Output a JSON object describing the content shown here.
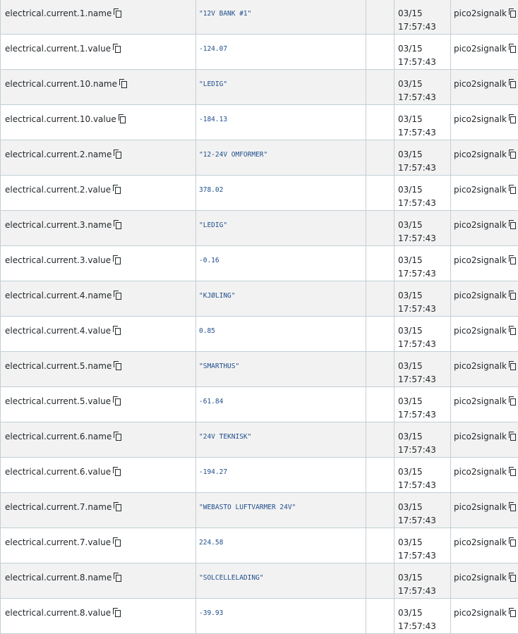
{
  "rows": [
    {
      "path": "electrical.current.1.name",
      "value": "\"12V BANK #1\"",
      "date": "03/15",
      "time": "17:57:43",
      "source": "pico2signalk"
    },
    {
      "path": "electrical.current.1.value",
      "value": "-124.07",
      "date": "03/15",
      "time": "17:57:43",
      "source": "pico2signalk"
    },
    {
      "path": "electrical.current.10.name",
      "value": "\"LEDIG\"",
      "date": "03/15",
      "time": "17:57:43",
      "source": "pico2signalk"
    },
    {
      "path": "electrical.current.10.value",
      "value": "-184.13",
      "date": "03/15",
      "time": "17:57:43",
      "source": "pico2signalk"
    },
    {
      "path": "electrical.current.2.name",
      "value": "\"12-24V OMFORMER\"",
      "date": "03/15",
      "time": "17:57:43",
      "source": "pico2signalk"
    },
    {
      "path": "electrical.current.2.value",
      "value": "378.02",
      "date": "03/15",
      "time": "17:57:43",
      "source": "pico2signalk"
    },
    {
      "path": "electrical.current.3.name",
      "value": "\"LEDIG\"",
      "date": "03/15",
      "time": "17:57:43",
      "source": "pico2signalk"
    },
    {
      "path": "electrical.current.3.value",
      "value": "-0.16",
      "date": "03/15",
      "time": "17:57:43",
      "source": "pico2signalk"
    },
    {
      "path": "electrical.current.4.name",
      "value": "\"KJØLING\"",
      "date": "03/15",
      "time": "17:57:43",
      "source": "pico2signalk"
    },
    {
      "path": "electrical.current.4.value",
      "value": "0.85",
      "date": "03/15",
      "time": "17:57:43",
      "source": "pico2signalk"
    },
    {
      "path": "electrical.current.5.name",
      "value": "\"SMARTHUS\"",
      "date": "03/15",
      "time": "17:57:43",
      "source": "pico2signalk"
    },
    {
      "path": "electrical.current.5.value",
      "value": "-61.84",
      "date": "03/15",
      "time": "17:57:43",
      "source": "pico2signalk"
    },
    {
      "path": "electrical.current.6.name",
      "value": "\"24V TEKNISK\"",
      "date": "03/15",
      "time": "17:57:43",
      "source": "pico2signalk"
    },
    {
      "path": "electrical.current.6.value",
      "value": "-194.27",
      "date": "03/15",
      "time": "17:57:43",
      "source": "pico2signalk"
    },
    {
      "path": "electrical.current.7.name",
      "value": "\"WEBASTO LUFTVARMER 24V\"",
      "date": "03/15",
      "time": "17:57:43",
      "source": "pico2signalk"
    },
    {
      "path": "electrical.current.7.value",
      "value": "224.58",
      "date": "03/15",
      "time": "17:57:43",
      "source": "pico2signalk"
    },
    {
      "path": "electrical.current.8.name",
      "value": "\"SOLCELLELADING\"",
      "date": "03/15",
      "time": "17:57:43",
      "source": "pico2signalk"
    },
    {
      "path": "electrical.current.8.value",
      "value": "-39.93",
      "date": "03/15",
      "time": "17:57:43",
      "source": "pico2signalk"
    }
  ],
  "icons": {
    "copy": "copy-icon"
  }
}
